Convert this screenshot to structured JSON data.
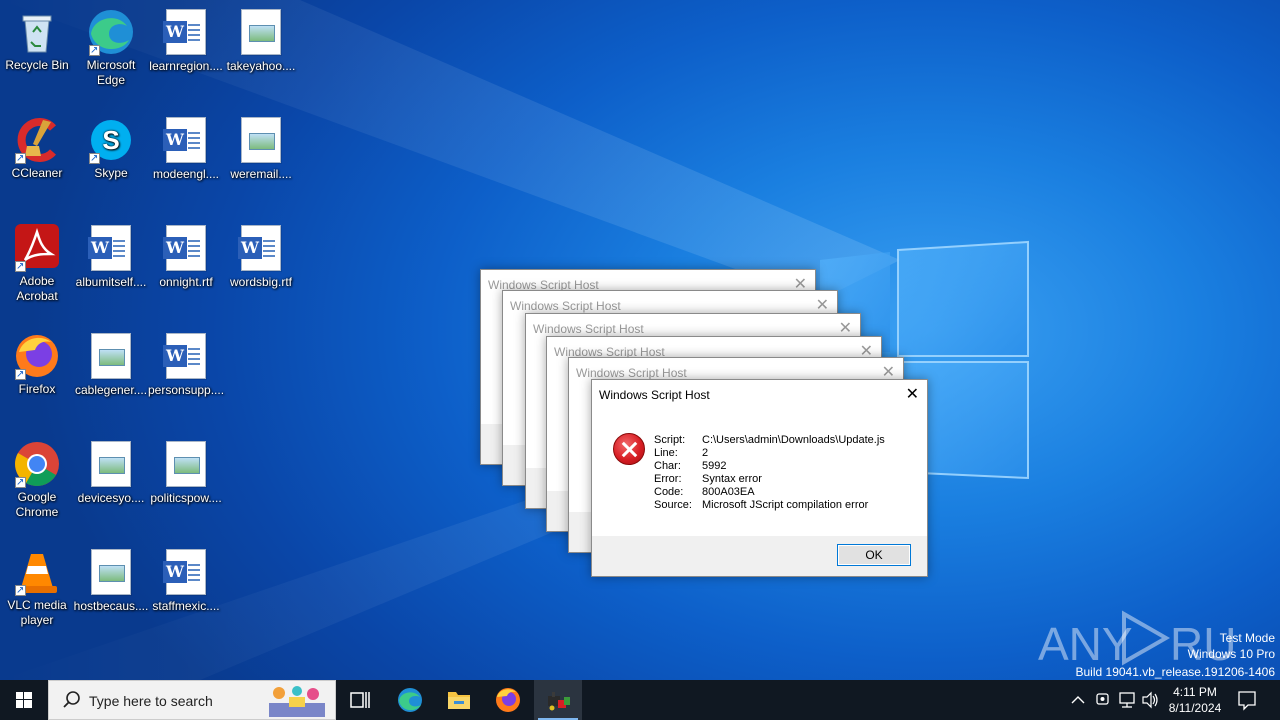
{
  "desktop": {
    "icons": [
      {
        "label": "Recycle Bin"
      },
      {
        "label": "Microsoft Edge"
      },
      {
        "label": "learnregion...."
      },
      {
        "label": "takeyahoo...."
      },
      {
        "label": "CCleaner"
      },
      {
        "label": "Skype"
      },
      {
        "label": "modeengl...."
      },
      {
        "label": "weremail...."
      },
      {
        "label": "Adobe Acrobat"
      },
      {
        "label": "albumitself...."
      },
      {
        "label": "onnight.rtf"
      },
      {
        "label": "wordsbig.rtf"
      },
      {
        "label": "Firefox"
      },
      {
        "label": "cablegener...."
      },
      {
        "label": "personsupp...."
      },
      {
        "label": "Google Chrome"
      },
      {
        "label": "devicesyo...."
      },
      {
        "label": "politicspow...."
      },
      {
        "label": "VLC media player"
      },
      {
        "label": "hostbecaus...."
      },
      {
        "label": "staffmexic...."
      }
    ]
  },
  "dialogs": {
    "title": "Windows Script Host",
    "close_glyph": "✕",
    "fields": [
      {
        "key": "Script:",
        "value": "C:\\Users\\admin\\Downloads\\Update.js"
      },
      {
        "key": "Line:",
        "value": "2"
      },
      {
        "key": "Char:",
        "value": "5992"
      },
      {
        "key": "Error:",
        "value": "Syntax error"
      },
      {
        "key": "Code:",
        "value": "800A03EA"
      },
      {
        "key": "Source:",
        "value": "Microsoft JScript compilation error"
      }
    ],
    "ok_label": "OK"
  },
  "taskbar": {
    "search_placeholder": "Type here to search",
    "time": "4:11 PM",
    "date": "8/11/2024",
    "apps": [
      "task-view",
      "edge",
      "file-explorer",
      "firefox",
      "script-host"
    ]
  },
  "watermark": {
    "brand": "ANY RUN",
    "line1": "Test Mode",
    "line2": "Windows 10 Pro",
    "line3": "Build 19041.vb_release.191206-1406"
  },
  "colors": {
    "wallpaper": "#0d5fc9",
    "taskbar": "#101822",
    "error_red": "#d81e24",
    "focus_blue": "#0078d7"
  }
}
